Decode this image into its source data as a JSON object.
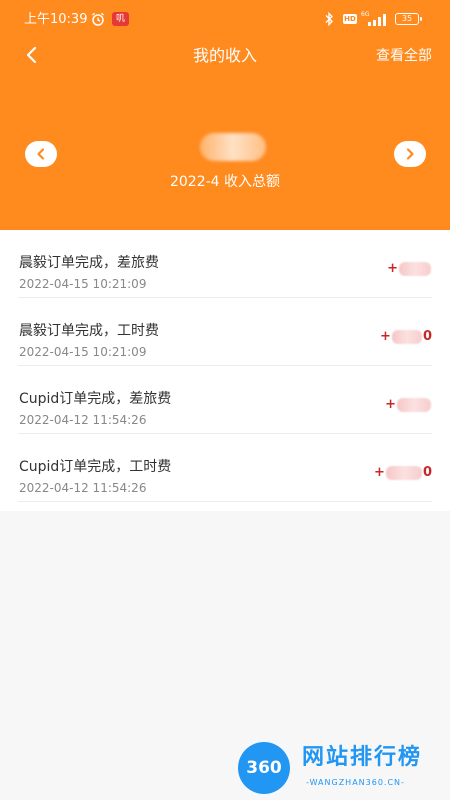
{
  "status_bar": {
    "time": "上午10:39",
    "badge": "叽",
    "network": "6G",
    "battery": "35"
  },
  "header": {
    "title": "我的收入",
    "view_all": "查看全部",
    "total_amount": "",
    "period_label": "2022-4 收入总额"
  },
  "records": [
    {
      "title": "晨毅订单完成，差旅费",
      "time": "2022-04-15 10:21:09",
      "amount_prefix": "+",
      "amount_suffix": ""
    },
    {
      "title": "晨毅订单完成，工时费",
      "time": "2022-04-15 10:21:09",
      "amount_prefix": "+",
      "amount_suffix": "0"
    },
    {
      "title": "Cupid订单完成，差旅费",
      "time": "2022-04-12 11:54:26",
      "amount_prefix": "+",
      "amount_suffix": ""
    },
    {
      "title": "Cupid订单完成，工时费",
      "time": "2022-04-12 11:54:26",
      "amount_prefix": "+",
      "amount_suffix": "0"
    }
  ],
  "watermark": {
    "circle": "360",
    "title": "网站排行榜",
    "subtitle": "-WANGZHAN360.CN-"
  },
  "colors": {
    "header": "#ff8a1e",
    "amount": "#c62828",
    "watermark": "#2196f3"
  }
}
